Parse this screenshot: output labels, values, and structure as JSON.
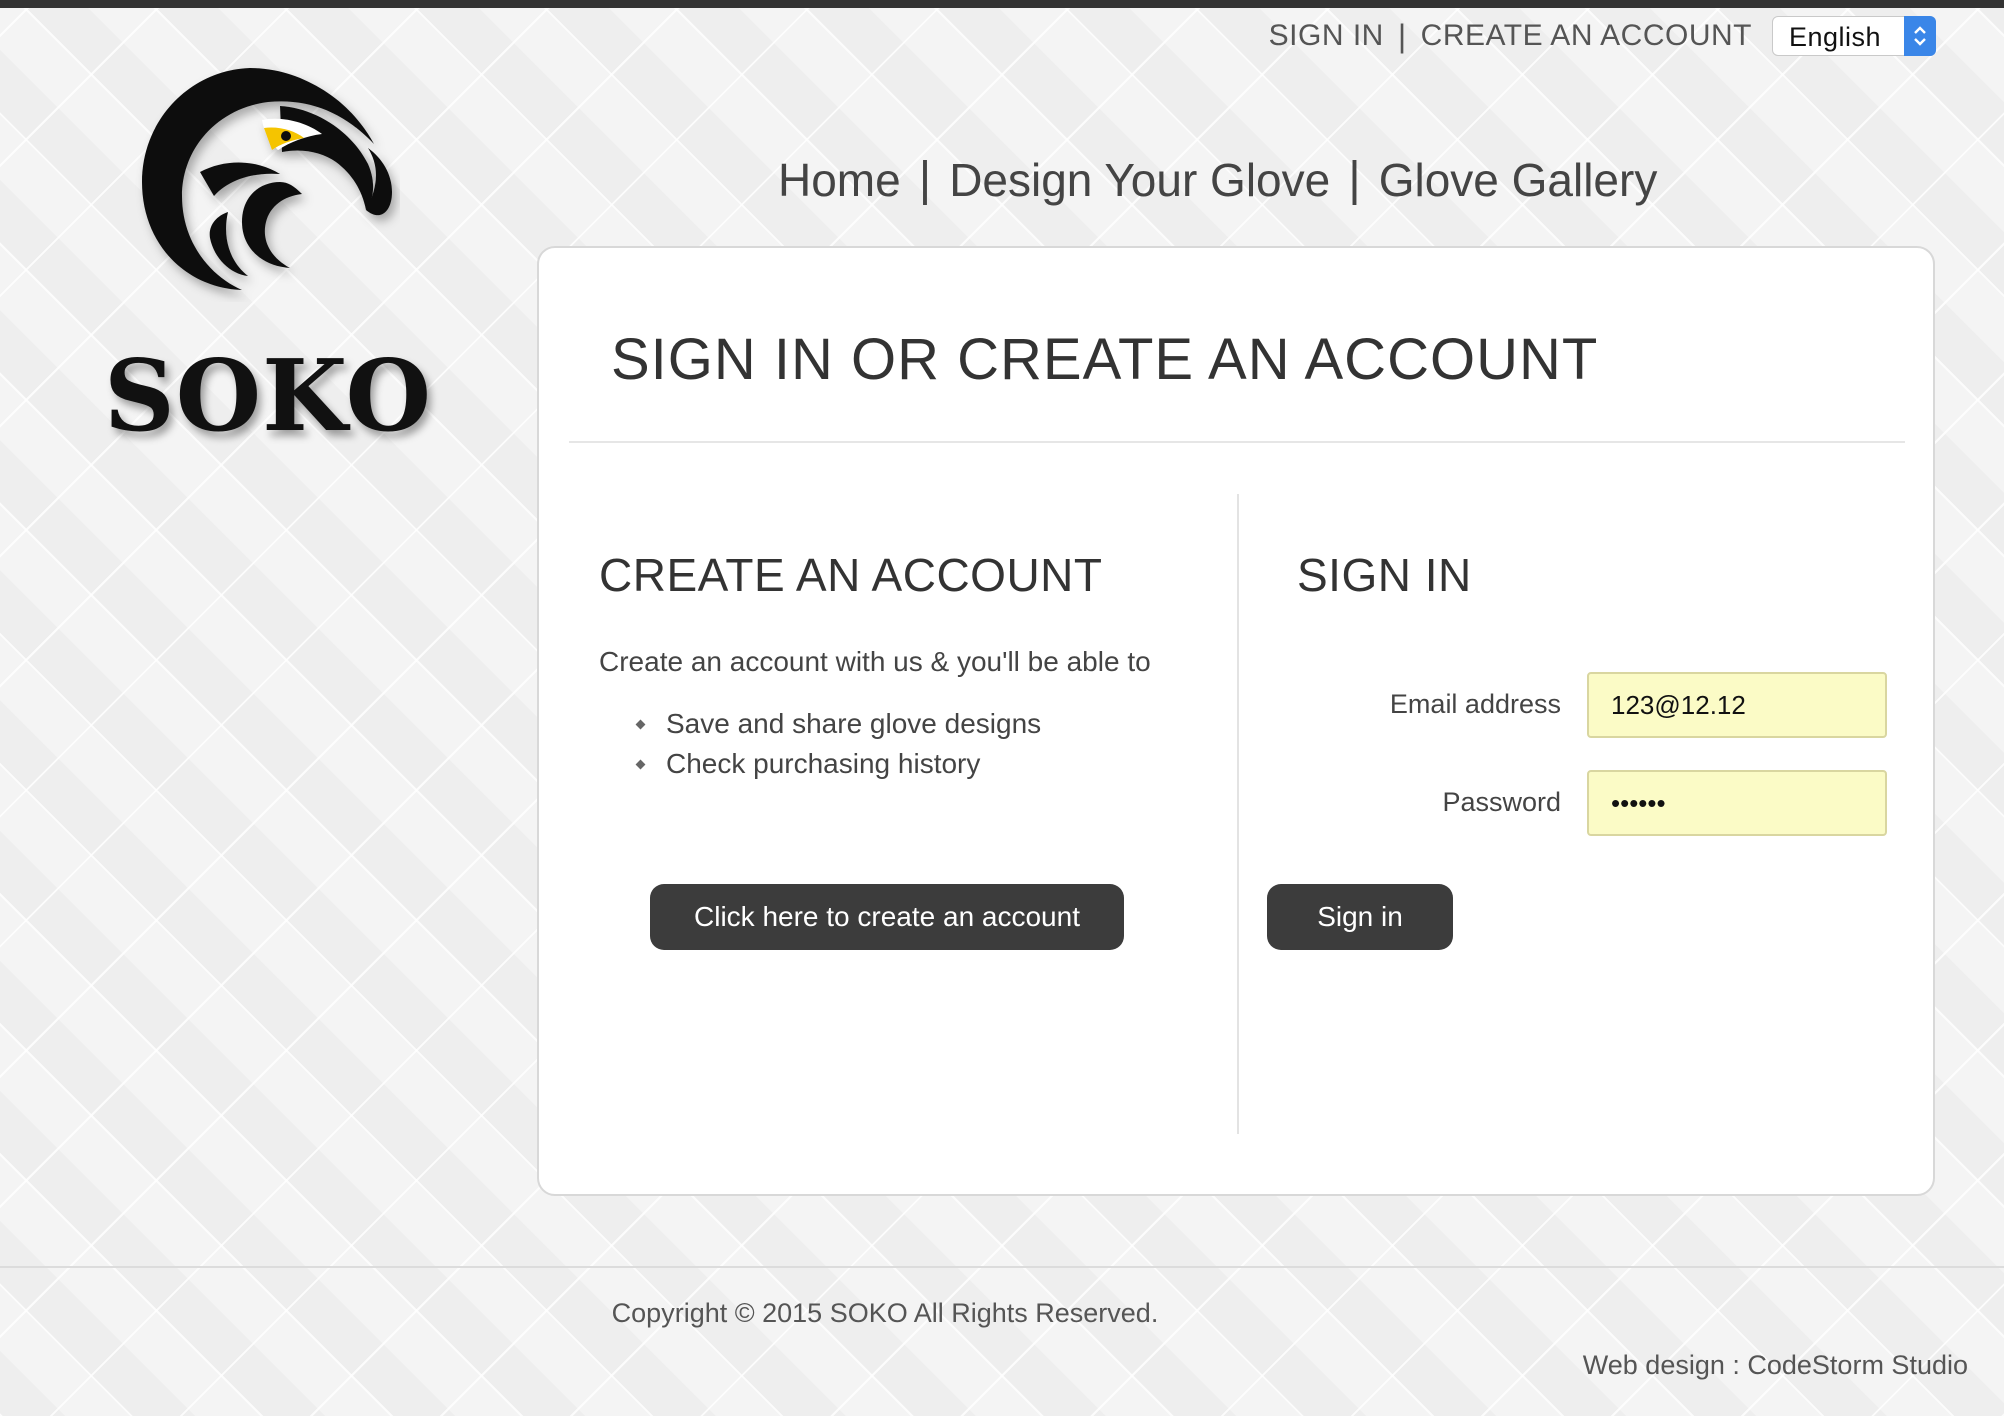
{
  "utility": {
    "sign_in": "SIGN IN",
    "separator": "|",
    "create_account": "CREATE AN ACCOUNT",
    "language": "English"
  },
  "logo": {
    "brand": "SOKO",
    "icon": "eagle-icon"
  },
  "nav": {
    "items": [
      {
        "label": "Home"
      },
      {
        "label": "Design Your Glove"
      },
      {
        "label": "Glove Gallery"
      }
    ],
    "separator": "|"
  },
  "panel": {
    "title": "SIGN IN OR CREATE AN ACCOUNT"
  },
  "create": {
    "heading": "CREATE AN ACCOUNT",
    "intro": "Create an account with us & you'll be able to",
    "benefits": [
      "Save and share glove designs",
      "Check purchasing history"
    ],
    "button": "Click here to create an account"
  },
  "signin": {
    "heading": "SIGN IN",
    "email_label": "Email address",
    "email_value": "123@12.12",
    "password_label": "Password",
    "password_value": "••••••",
    "button": "Sign in"
  },
  "footer": {
    "copyright": "Copyright © 2015 SOKO All Rights Reserved.",
    "credit": "Web design : CodeStorm Studio"
  },
  "colors": {
    "button_bg": "#3c3c3c",
    "input_autofill": "#fbfbc6",
    "select_accent": "#3a86e8",
    "eagle_eye": "#f5c400"
  }
}
